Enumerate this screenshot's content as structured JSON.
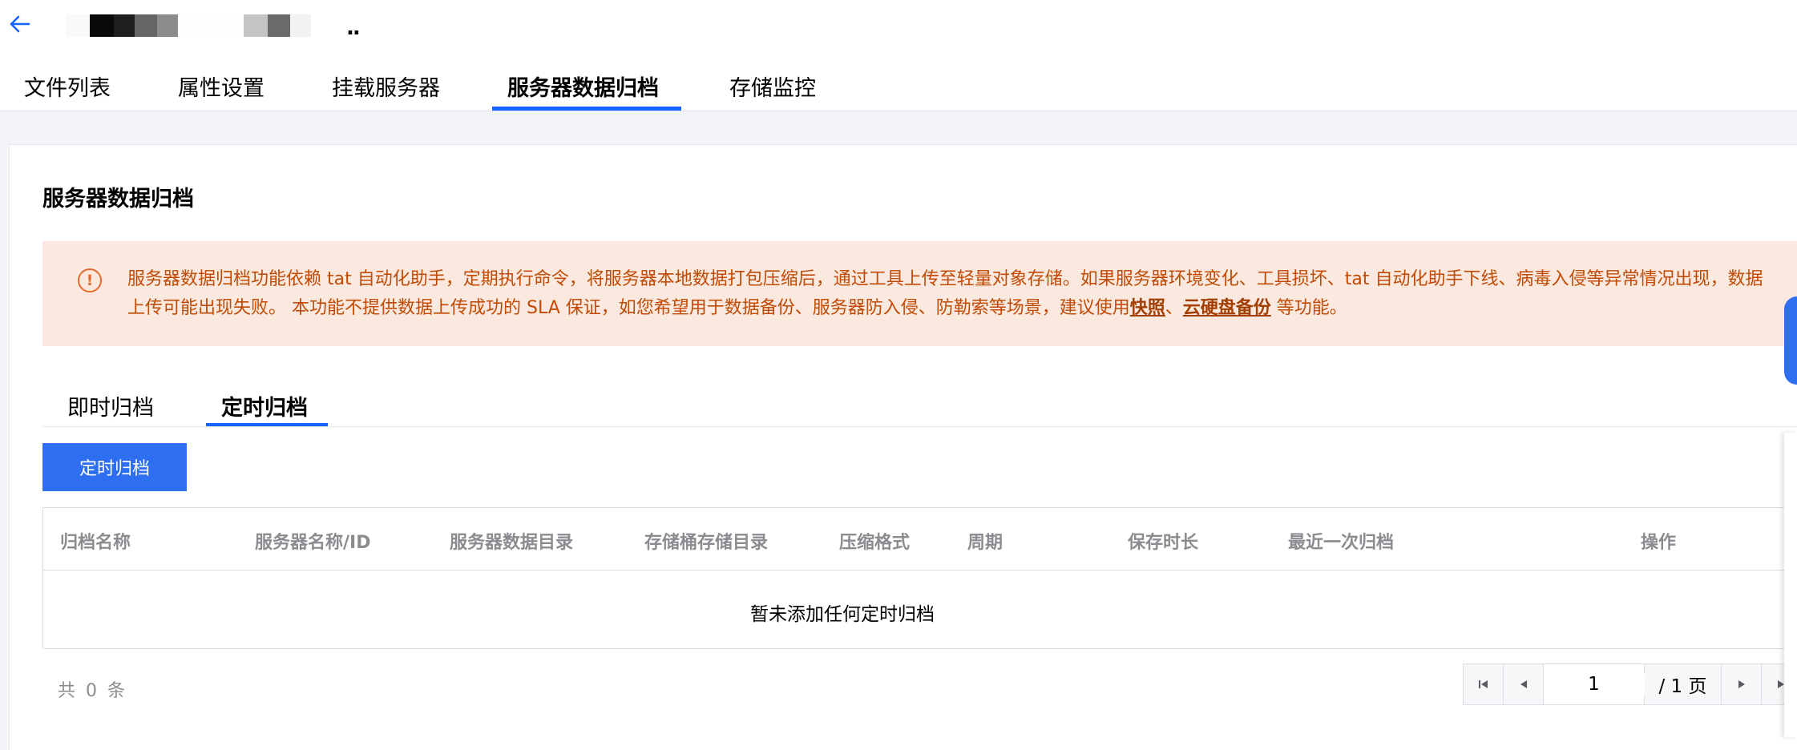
{
  "header": {
    "tabs": [
      "文件列表",
      "属性设置",
      "挂载服务器",
      "服务器数据归档",
      "存储监控"
    ],
    "active_tab": "服务器数据归档",
    "title_suffix": ".."
  },
  "section": {
    "title": "服务器数据归档"
  },
  "alert": {
    "text_part1": "服务器数据归档功能依赖 tat 自动化助手，定期执行命令，将服务器本地数据打包压缩后，通过工具上传至轻量对象存储。如果服务器环境变化、工具损坏、tat 自动化助手下线、病毒入侵等异常情况出现，数据上传可能出现失败。 本功能不提供数据上传成功的 SLA 保证，如您希望用于数据备份、服务器防入侵、防勒索等场景，建议使用",
    "link1": "快照",
    "separator": "、",
    "link2": "云硬盘备份",
    "text_part2": " 等功能。"
  },
  "subtabs": [
    "即时归档",
    "定时归档"
  ],
  "active_subtab": "定时归档",
  "primary_button": "定时归档",
  "table": {
    "columns": [
      "归档名称",
      "服务器名称/ID",
      "服务器数据目录",
      "存储桶存储目录",
      "压缩格式",
      "周期",
      "保存时长",
      "最近一次归档",
      "操作"
    ],
    "empty_text": "暂未添加任何定时归档"
  },
  "footer": {
    "total_text": "共 0 条",
    "page_value": "1",
    "page_total": "/ 1 页"
  },
  "colors": {
    "accent": "#1664ff",
    "button": "#2e6ef0",
    "alert_bg": "#fbe9df",
    "alert_text": "#c14a05"
  }
}
